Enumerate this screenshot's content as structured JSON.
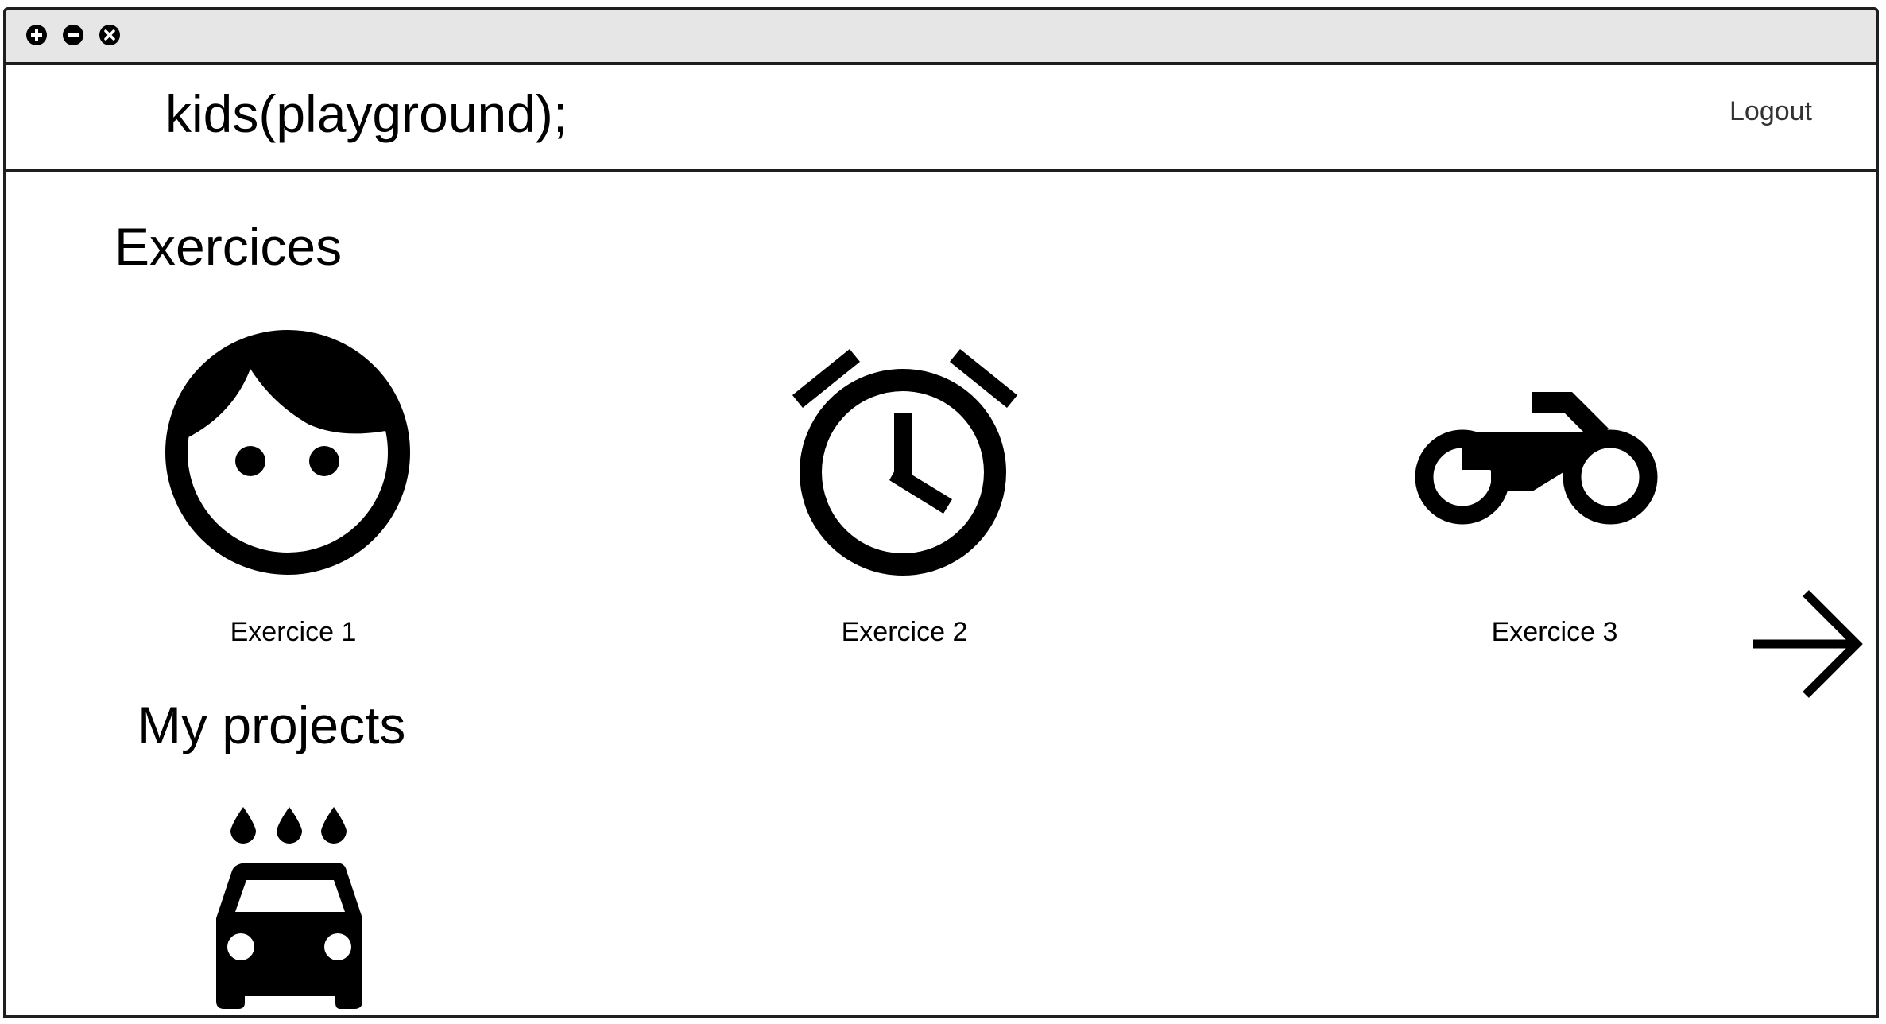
{
  "window": {
    "controls": [
      {
        "name": "maximize-icon"
      },
      {
        "name": "minimize-icon"
      },
      {
        "name": "close-icon"
      }
    ]
  },
  "header": {
    "brand": "kids(playground);",
    "logout_label": "Logout"
  },
  "exercises": {
    "title": "Exercices",
    "items": [
      {
        "label": "Exercice 1",
        "icon": "face-icon"
      },
      {
        "label": "Exercice 2",
        "icon": "alarm-clock-icon"
      },
      {
        "label": "Exercice 3",
        "icon": "motorcycle-icon"
      }
    ],
    "next_icon": "arrow-right-icon"
  },
  "projects": {
    "title": "My projects",
    "items": [
      {
        "label": "",
        "icon": "car-wash-icon"
      }
    ]
  },
  "colors": {
    "border": "#1e1e1e",
    "titlebar": "#e6e6e6",
    "icon": "#000000",
    "logout_text": "#333333"
  }
}
